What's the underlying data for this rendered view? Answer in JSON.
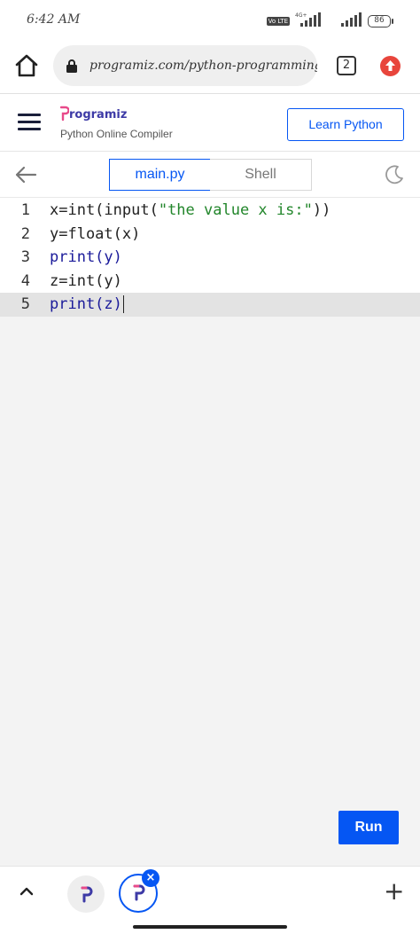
{
  "status_bar": {
    "time": "6:42 AM",
    "network": "4G+",
    "volte": "Vo LTE",
    "battery": "86"
  },
  "browser": {
    "url": "programiz.com/python-programming/",
    "tab_count": "2"
  },
  "site": {
    "brand": "rogramiz",
    "subtitle": "Python Online Compiler",
    "learn_button": "Learn Python"
  },
  "tabs": [
    {
      "label": "main.py",
      "active": true
    },
    {
      "label": "Shell",
      "active": false
    }
  ],
  "editor": {
    "lines": [
      {
        "number": "1",
        "text": "x=int(input(\"the value x is:\"))"
      },
      {
        "number": "2",
        "text": "y=float(x)"
      },
      {
        "number": "3",
        "text": "print(y)"
      },
      {
        "number": "4",
        "text": "z=int(y)"
      },
      {
        "number": "5",
        "text": "print(z)"
      }
    ],
    "active_line": 5
  },
  "run_button": "Run",
  "bottom_bar": {
    "close_glyph": "×",
    "add_glyph": "+"
  },
  "colors": {
    "accent": "#0556f3",
    "brand": "#3d3aa6",
    "string": "#22862b",
    "keyword": "#1a1a9a",
    "update_badge": "#e8453c"
  }
}
